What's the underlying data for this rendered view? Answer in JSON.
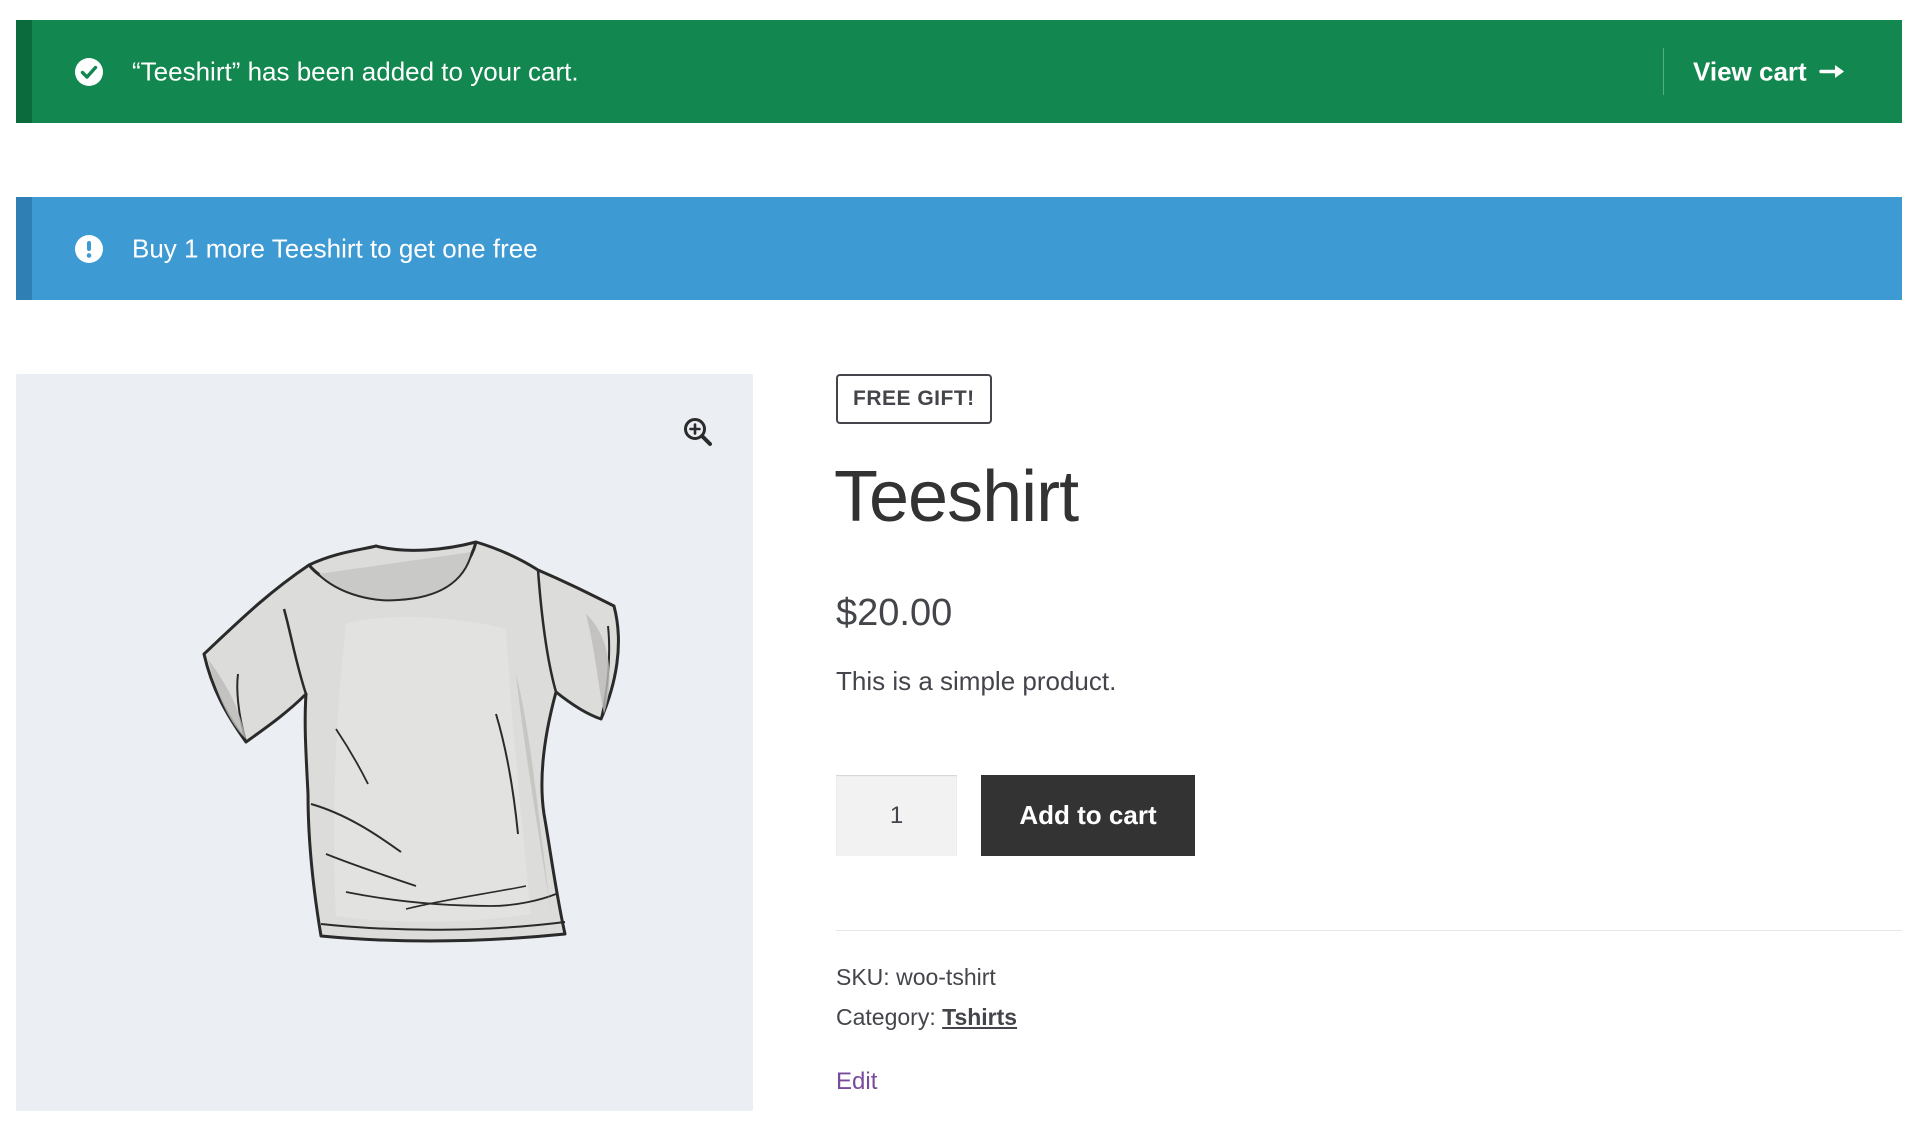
{
  "notices": {
    "success": {
      "message": "“Teeshirt” has been added to your cart.",
      "action_label": "View cart",
      "icon": "check-circle-icon",
      "color": "#12874f"
    },
    "info": {
      "message": "Buy 1 more Teeshirt to get one free",
      "icon": "exclamation-circle-icon",
      "color": "#3e9ad3"
    }
  },
  "gallery": {
    "zoom_icon": "zoom-in-icon",
    "image_icon": "tshirt-image",
    "background": "#ebeff3"
  },
  "product": {
    "badge": "FREE GIFT!",
    "title": "Teeshirt",
    "price": "$20.00",
    "description": "This is a simple product.",
    "quantity": "1",
    "add_to_cart_label": "Add to cart",
    "sku_label": "SKU:",
    "sku_value": "woo-tshirt",
    "category_label": "Category:",
    "category_value": "Tshirts",
    "edit_label": "Edit"
  },
  "colors": {
    "button_bg": "#333333",
    "edit_link": "#7a4b9c",
    "text": "#43454b"
  }
}
